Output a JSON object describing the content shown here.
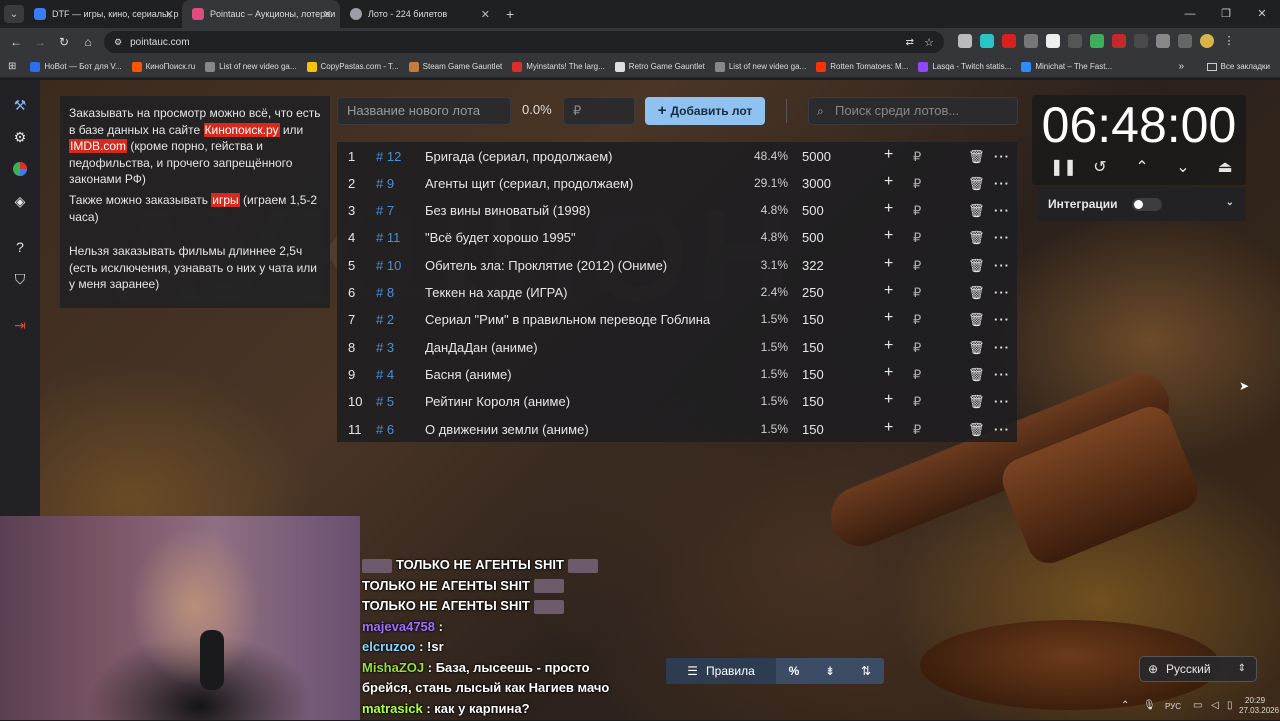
{
  "browser": {
    "tabs": [
      {
        "title": "DTF — игры, кино, сериалы, р",
        "fav_color": "#3b7bf6"
      },
      {
        "title": "Pointauc – Аукционы, лотереи",
        "fav_color": "#e04c7c"
      },
      {
        "title": "Лото - 224 билетов",
        "fav_color": "#9aa0a6"
      }
    ],
    "url": "pointauc.com",
    "bookmarks": [
      {
        "label": "HoBot — Бот для V...",
        "color": "#2c6ef2"
      },
      {
        "label": "КиноПоиск.ru",
        "color": "#ff5500"
      },
      {
        "label": "List of new video ga...",
        "color": "#888888"
      },
      {
        "label": "CopyPastas.com - T...",
        "color": "#f5c400"
      },
      {
        "label": "Steam Game Gauntlet",
        "color": "#c77a40"
      },
      {
        "label": "Myinstants! The larg...",
        "color": "#d9302c"
      },
      {
        "label": "Retro Game Gauntlet",
        "color": "#dddddd"
      },
      {
        "label": "List of new video ga...",
        "color": "#888888"
      },
      {
        "label": "Rotten Tomatoes: M...",
        "color": "#fa320a"
      },
      {
        "label": "Lasqa - Twitch statis...",
        "color": "#9146ff"
      },
      {
        "label": "Minichat – The Fast...",
        "color": "#2d8cff"
      }
    ],
    "all_bookmarks": "Все закладки"
  },
  "rules": {
    "p1_a": "Заказывать на просмотр можно всё, что есть в базе данных на сайте ",
    "p1_link1": "Кинопоиск.ру",
    "p1_b": " или ",
    "p1_link2": "IMDB.com",
    "p1_c": " (кроме порно, гейства и педофильства, и прочего запрещённого законами РФ)",
    "p2_a": "Также можно заказывать ",
    "p2_hl": "игры",
    "p2_b": " (играем 1,5-2 часа)",
    "p3": "Нельзя заказывать фильмы длиннее 2,5ч (есть исключения, узнавать о них у чата или у меня заранее)"
  },
  "toolbar": {
    "lot_placeholder": "Название нового лота",
    "percent": "0.0%",
    "currency": "₽",
    "add_label": "Добавить лот",
    "search_placeholder": "Поиск среди лотов..."
  },
  "lots": [
    {
      "idx": "1",
      "id": "# 12",
      "name": "Бригада (сериал, продолжаем)",
      "pct": "48.4%",
      "amount": "5000"
    },
    {
      "idx": "2",
      "id": "# 9",
      "name": "Агенты щит (сериал, продолжаем)",
      "pct": "29.1%",
      "amount": "3000"
    },
    {
      "idx": "3",
      "id": "# 7",
      "name": "Без вины виноватый (1998)",
      "pct": "4.8%",
      "amount": "500"
    },
    {
      "idx": "4",
      "id": "# 11",
      "name": "\"Всё будет хорошо 1995\"",
      "pct": "4.8%",
      "amount": "500"
    },
    {
      "idx": "5",
      "id": "# 10",
      "name": "Обитель зла: Проклятие (2012) (Ониме)",
      "pct": "3.1%",
      "amount": "322"
    },
    {
      "idx": "6",
      "id": "# 8",
      "name": "Теккен на харде (ИГРА)",
      "pct": "2.4%",
      "amount": "250"
    },
    {
      "idx": "7",
      "id": "# 2",
      "name": "Сериал \"Рим\" в правильном переводе Гоблина",
      "pct": "1.5%",
      "amount": "150"
    },
    {
      "idx": "8",
      "id": "# 3",
      "name": "ДанДаДан (аниме)",
      "pct": "1.5%",
      "amount": "150"
    },
    {
      "idx": "9",
      "id": "# 4",
      "name": "Басня (аниме)",
      "pct": "1.5%",
      "amount": "150"
    },
    {
      "idx": "10",
      "id": "# 5",
      "name": "Рейтинг Короля (аниме)",
      "pct": "1.5%",
      "amount": "150"
    },
    {
      "idx": "11",
      "id": "# 6",
      "name": "О движении земли (аниме)",
      "pct": "1.5%",
      "amount": "150"
    }
  ],
  "lot_row": {
    "plus": "+",
    "rub": "₽",
    "del": "🗑",
    "more": "···"
  },
  "timer": {
    "value": "06:48:00"
  },
  "integrations": {
    "label": "Интеграции"
  },
  "chat": [
    {
      "user": "",
      "text": "ТОЛЬКО НЕ АГЕНТЫ SHIT",
      "user_color": "#ffffff"
    },
    {
      "user": "",
      "text": "ТОЛЬКО НЕ АГЕНТЫ SHIT",
      "user_color": "#ffffff"
    },
    {
      "user": "",
      "text": "ТОЛЬКО НЕ АГЕНТЫ SHIT",
      "user_color": "#ffffff"
    },
    {
      "user": "majeva4758",
      "text": "",
      "user_color": "#a070ff"
    },
    {
      "user": "elcruzoo",
      "text": "!sr",
      "user_color": "#8ad4ff"
    },
    {
      "user": "MishaZOJ",
      "text": "База, лысеешь - просто",
      "user_color": "#9bdc3c"
    },
    {
      "user": "",
      "text": "брейся, стань лысый как Нагиев мачо",
      "user_color": "#ffffff"
    },
    {
      "user": "matrasick",
      "text": "как у карпина?",
      "user_color": "#b0ff40"
    }
  ],
  "bottombar": {
    "rules_label": "Правила",
    "percent_icon": "%"
  },
  "language": {
    "label": "Русский"
  },
  "tray": {
    "kbd": "РУС",
    "time": "20:29",
    "date": "27.03.2026"
  }
}
